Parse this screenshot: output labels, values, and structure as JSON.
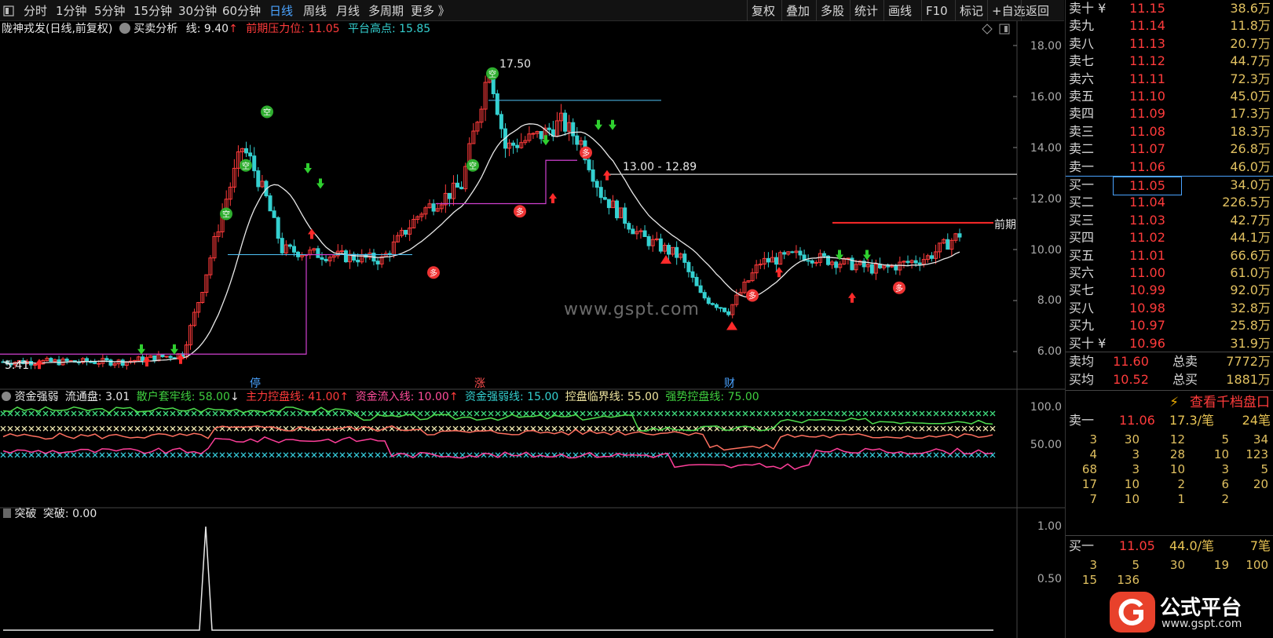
{
  "toolbar": {
    "left_items": [
      "分时",
      "1分钟",
      "5分钟",
      "15分钟",
      "30分钟",
      "60分钟",
      "日线",
      "周线",
      "月线",
      "多周期",
      "更多 》"
    ],
    "active": "日线",
    "right_items": [
      "复权",
      "叠加",
      "多股",
      "统计",
      "画线",
      "F10",
      "标记",
      "+自选",
      "返回"
    ]
  },
  "main_header": {
    "stock": "陇神戎发(日线,前复权)",
    "indicator": "买卖分析",
    "line_label": "线: 9.40",
    "line_arrow": "↑",
    "pressure_label": "前期压力位: 11.05",
    "platform_label": "平台高点: 15.85"
  },
  "chart_annotations": {
    "peak": "17.50",
    "low": "5.41",
    "level": "13.00 - 12.89",
    "pressure_tag": "前期",
    "watermark": "www.gspt.com",
    "marker_kong": "空",
    "marker_duo": "多",
    "event_ting": "停",
    "event_zhang": "涨",
    "event_cai": "财"
  },
  "main_axis": [
    "18.00",
    "16.00",
    "14.00",
    "12.00",
    "10.00",
    "8.00",
    "6.00"
  ],
  "fund_header": {
    "name": "资金强弱",
    "float": "流通盘: 3.01",
    "retail": "散户套牢线: 58.00",
    "retail_arrow": "↓",
    "main": "主力控盘线: 41.00",
    "main_arrow": "↑",
    "inflow": "资金流入线: 10.00",
    "inflow_arrow": "↑",
    "strength": "资金强弱线: 15.00",
    "critical": "控盘临界线: 55.00",
    "strong": "强势控盘线: 75.00"
  },
  "fund_axis": [
    "100.0",
    "50.00"
  ],
  "break_header": {
    "name": "突破",
    "value": "突破: 0.00"
  },
  "break_axis": [
    "1.00",
    "0.50"
  ],
  "orderbook": {
    "sells": [
      {
        "label": "卖十",
        "tag": "¥",
        "price": "11.15",
        "vol": "38.6万"
      },
      {
        "label": "卖九",
        "price": "11.14",
        "vol": "11.8万"
      },
      {
        "label": "卖八",
        "price": "11.13",
        "vol": "20.7万"
      },
      {
        "label": "卖七",
        "price": "11.12",
        "vol": "44.7万"
      },
      {
        "label": "卖六",
        "price": "11.11",
        "vol": "72.3万"
      },
      {
        "label": "卖五",
        "price": "11.10",
        "vol": "45.0万"
      },
      {
        "label": "卖四",
        "price": "11.09",
        "vol": "17.3万"
      },
      {
        "label": "卖三",
        "price": "11.08",
        "vol": "18.3万"
      },
      {
        "label": "卖二",
        "price": "11.07",
        "vol": "26.8万"
      },
      {
        "label": "卖一",
        "price": "11.06",
        "vol": "46.0万"
      }
    ],
    "buys": [
      {
        "label": "买一",
        "price": "11.05",
        "vol": "34.0万"
      },
      {
        "label": "买二",
        "price": "11.04",
        "vol": "226.5万"
      },
      {
        "label": "买三",
        "price": "11.03",
        "vol": "42.7万"
      },
      {
        "label": "买四",
        "price": "11.02",
        "vol": "44.1万"
      },
      {
        "label": "买五",
        "price": "11.01",
        "vol": "66.6万"
      },
      {
        "label": "买六",
        "price": "11.00",
        "vol": "61.0万"
      },
      {
        "label": "买七",
        "price": "10.99",
        "vol": "92.0万"
      },
      {
        "label": "买八",
        "price": "10.98",
        "vol": "32.8万"
      },
      {
        "label": "买九",
        "price": "10.97",
        "vol": "25.8万"
      },
      {
        "label": "买十",
        "tag": "¥",
        "price": "10.96",
        "vol": "31.9万"
      }
    ],
    "avg_sell": {
      "label": "卖均",
      "price": "11.60",
      "total_label": "总卖",
      "total": "7772万"
    },
    "avg_buy": {
      "label": "买均",
      "price": "10.52",
      "total_label": "总买",
      "total": "1881万"
    },
    "view_button": "查看千档盘口",
    "sell1": {
      "label": "卖一",
      "price": "11.06",
      "size": "17.3/笔",
      "count": "24笔"
    },
    "sell_queue": [
      [
        "3",
        "30",
        "12",
        "5",
        "34"
      ],
      [
        "4",
        "3",
        "28",
        "10",
        "123"
      ],
      [
        "68",
        "3",
        "10",
        "3",
        "5"
      ],
      [
        "17",
        "10",
        "2",
        "6",
        "20"
      ],
      [
        "7",
        "10",
        "1",
        "2",
        ""
      ]
    ],
    "buy1": {
      "label": "买一",
      "price": "11.05",
      "size": "44.0/笔",
      "count": "7笔"
    },
    "buy_queue": [
      [
        "3",
        "5",
        "30",
        "19",
        "100"
      ],
      [
        "15",
        "136",
        "",
        "",
        ""
      ]
    ]
  },
  "logo": {
    "text": "公式平台",
    "url": "www.gspt.com"
  },
  "colors": {
    "up": "#ff3b3b",
    "down": "#34d0d0",
    "ma": "#e8e8e8",
    "bg": "#000000",
    "accent": "#4aa3ff"
  }
}
